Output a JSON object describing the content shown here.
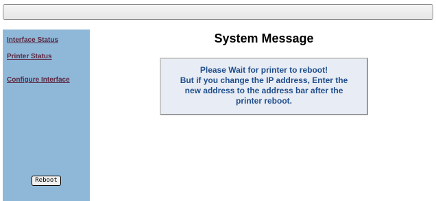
{
  "sidebar": {
    "links": [
      {
        "label": "Interface Status"
      },
      {
        "label": "Printer Status"
      },
      {
        "label": "Configure Interface"
      }
    ],
    "reboot_label": "Reboot"
  },
  "main": {
    "title": "System Message",
    "message_lines": [
      "Please Wait for printer to reboot!",
      "But if you change the IP address, Enter the",
      "new address to the address bar after the",
      "printer reboot."
    ]
  },
  "colors": {
    "sidebar_bg": "#8fb8d8",
    "link_color": "#5a2740",
    "message_text": "#1f4e8c",
    "message_bg": "#e8ecf4"
  }
}
